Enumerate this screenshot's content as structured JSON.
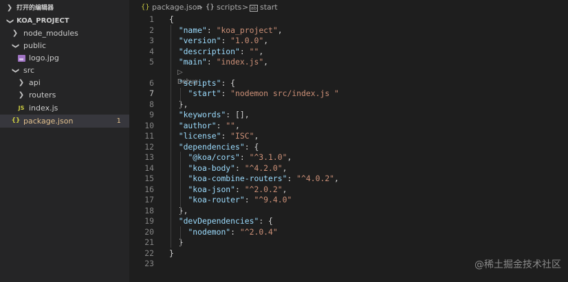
{
  "explorer": {
    "open_editors_label": "打开的编辑器",
    "project_label": "KOA_PROJECT",
    "items": [
      {
        "label": "node_modules",
        "type": "folder"
      },
      {
        "label": "public",
        "type": "folder"
      },
      {
        "label": "logo.jpg",
        "type": "image"
      },
      {
        "label": "src",
        "type": "folder"
      },
      {
        "label": "api",
        "type": "folder"
      },
      {
        "label": "routers",
        "type": "folder"
      },
      {
        "label": "index.js",
        "type": "js"
      },
      {
        "label": "package.json",
        "type": "json",
        "badge": "1"
      }
    ],
    "icons": {
      "js": "JS",
      "json": "{}"
    }
  },
  "breadcrumb": {
    "file": "package.json",
    "separator": ">",
    "path1": "scripts",
    "path2": "start",
    "brace_icon": "{}"
  },
  "editor": {
    "codelens": "▷ Debug",
    "lines": [
      {
        "n": "1",
        "t": "{"
      },
      {
        "n": "2",
        "t": "  \"name\": \"koa_project\","
      },
      {
        "n": "3",
        "t": "  \"version\": \"1.0.0\","
      },
      {
        "n": "4",
        "t": "  \"description\": \"\","
      },
      {
        "n": "5",
        "t": "  \"main\": \"index.js\","
      },
      {
        "n": "6",
        "t": "  \"scripts\": {"
      },
      {
        "n": "7",
        "t": "    \"start\": \"nodemon src/index.js \""
      },
      {
        "n": "8",
        "t": "  },"
      },
      {
        "n": "9",
        "t": "  \"keywords\": [],"
      },
      {
        "n": "10",
        "t": "  \"author\": \"\","
      },
      {
        "n": "11",
        "t": "  \"license\": \"ISC\","
      },
      {
        "n": "12",
        "t": "  \"dependencies\": {"
      },
      {
        "n": "13",
        "t": "    \"@koa/cors\": \"^3.1.0\","
      },
      {
        "n": "14",
        "t": "    \"koa-body\": \"^4.2.0\","
      },
      {
        "n": "15",
        "t": "    \"koa-combine-routers\": \"^4.0.2\","
      },
      {
        "n": "16",
        "t": "    \"koa-json\": \"^2.0.2\","
      },
      {
        "n": "17",
        "t": "    \"koa-router\": \"^9.4.0\""
      },
      {
        "n": "18",
        "t": "  },"
      },
      {
        "n": "19",
        "t": "  \"devDependencies\": {"
      },
      {
        "n": "20",
        "t": "    \"nodemon\": \"^2.0.4\""
      },
      {
        "n": "21",
        "t": "  }"
      },
      {
        "n": "22",
        "t": "}"
      },
      {
        "n": "23",
        "t": ""
      }
    ]
  },
  "watermark": "@稀土掘金技术社区",
  "colors": {
    "key": "#9cdcfe",
    "string": "#ce9178",
    "punct": "#d4d4d4",
    "modified": "#e2c08d"
  }
}
